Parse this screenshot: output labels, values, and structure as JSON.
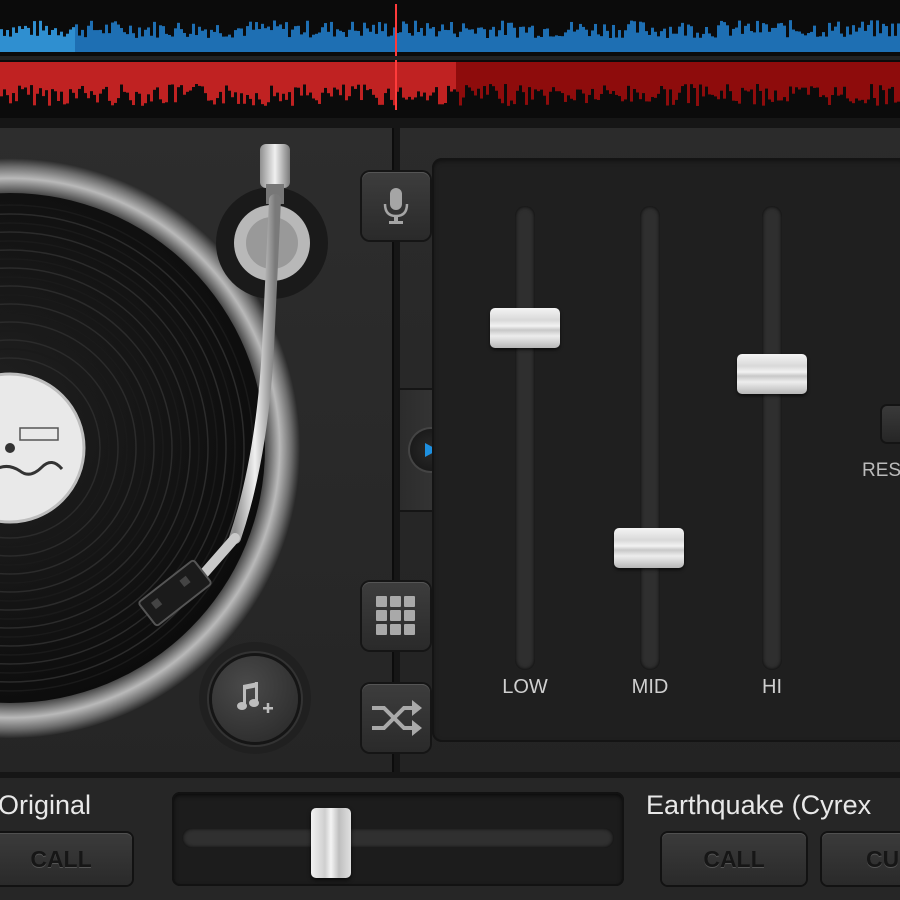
{
  "waveforms": {
    "deck_a_color": "#1e6fb3",
    "deck_a_played_color": "#2f8fd0",
    "deck_b_color": "#8e0c0c",
    "deck_b_played_color": "#c02222",
    "playhead_color": "#ff3b3b"
  },
  "deck_left": {
    "platter_label": "",
    "buttons": {
      "mic": "microphone-icon",
      "play": "play-icon",
      "pads": "grid-icon",
      "shuffle": "shuffle-icon",
      "add_music": "music-note-add-icon"
    }
  },
  "eq": {
    "low_label": "LOW",
    "mid_label": "MID",
    "hi_label": "HI",
    "low_level": 0.76,
    "mid_level": 0.24,
    "hi_level": 0.65,
    "reset_label": "RES"
  },
  "bottom": {
    "left_track_title": "Original",
    "left_call_label": "CALL",
    "right_track_title": "Earthquake (Cyrex",
    "right_call_label": "CALL",
    "right_cue_label": "CU",
    "crossfader_position": 0.33
  },
  "colors": {
    "accent": "#1e90e0"
  }
}
